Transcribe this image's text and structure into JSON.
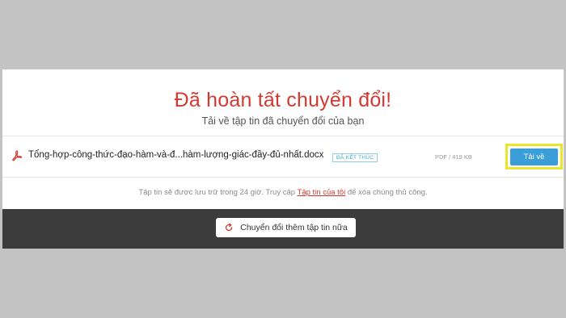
{
  "main": {
    "headline": "Đã hoàn tất chuyển đổi!",
    "subheadline": "Tải về tập tin đã chuyển đổi của bạn"
  },
  "file": {
    "icon": "pdf-icon",
    "name": "Tổng-hợp-công-thức-đạo-hàm-và-đ...hàm-lượng-giác-đầy-đủ-nhất.docx",
    "status": "ĐÃ KẾT THÚC",
    "meta": "PDF / 419 KB",
    "download_label": "Tải về"
  },
  "storage_note": {
    "before": "Tập tin sẽ được lưu trữ trong 24 giờ. Truy cập ",
    "link": "Tập tin của tôi",
    "after": " để xóa chúng thủ công."
  },
  "footer": {
    "icon": "refresh-icon",
    "convert_more_label": "Chuyển đổi thêm tập tin nữa"
  },
  "colors": {
    "accent_red": "#d23a31",
    "button_blue": "#3a9fd8",
    "highlight_yellow": "#e9e62c",
    "bottom_bar": "#3c3c3c"
  }
}
